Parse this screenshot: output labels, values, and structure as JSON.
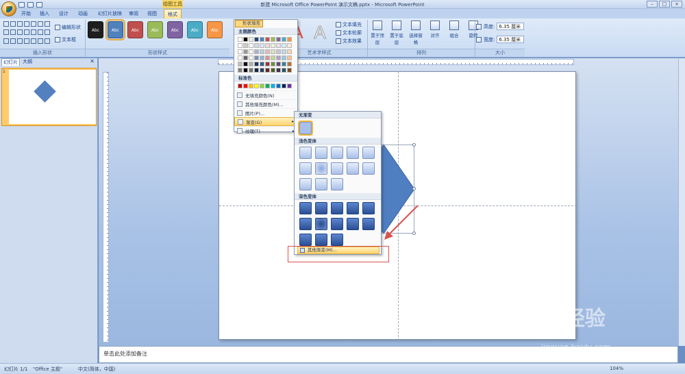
{
  "window": {
    "title": "新建 Microsoft Office PowerPoint 演示文稿.pptx - Microsoft PowerPoint",
    "contextual_tab": "绘图工具"
  },
  "tabs": [
    {
      "label": "开始"
    },
    {
      "label": "插入"
    },
    {
      "label": "设计"
    },
    {
      "label": "动画"
    },
    {
      "label": "幻灯片放映"
    },
    {
      "label": "审阅"
    },
    {
      "label": "视图"
    },
    {
      "label": "格式"
    }
  ],
  "ribbon": {
    "insert_shapes": {
      "label": "插入形状",
      "edit_shape": "编辑形状",
      "textbox": "文本框"
    },
    "shape_styles": {
      "label": "形状样式",
      "style_text": "Abc",
      "swatches": [
        "#1e1e1e",
        "#4f81bd",
        "#c0504d",
        "#9bbb59",
        "#8064a2",
        "#4bacc6",
        "#f79646"
      ]
    },
    "wordart": {
      "label": "艺术字样式",
      "text_fill": "文本填充",
      "text_outline": "文本轮廓",
      "text_effect": "文本效果"
    },
    "arrange": {
      "label": "排列",
      "bring_front": "置于顶层",
      "send_back": "置于底层",
      "select_pane": "选择窗格",
      "align": "对齐",
      "group": "组合",
      "rotate": "旋转"
    },
    "size": {
      "label": "大小",
      "height_label": "高度:",
      "height_value": "6.35 厘米",
      "width_label": "宽度:",
      "width_value": "6.35 厘米"
    }
  },
  "fill_menu": {
    "trigger": "形状填充",
    "theme_colors_label": "主题颜色",
    "standard_colors_label": "标准色",
    "theme_colors": [
      "#ffffff",
      "#000000",
      "#eeece1",
      "#1f497d",
      "#4f81bd",
      "#c0504d",
      "#9bbb59",
      "#8064a2",
      "#4bacc6",
      "#f79646"
    ],
    "standard_colors": [
      "#c00000",
      "#ff0000",
      "#ffc000",
      "#ffff00",
      "#92d050",
      "#00b050",
      "#00b0f0",
      "#0070c0",
      "#002060",
      "#7030a0"
    ],
    "items": [
      {
        "label": "无填充颜色(N)"
      },
      {
        "label": "其他填充颜色(M)..."
      },
      {
        "label": "图片(P)..."
      },
      {
        "label": "渐变(G)"
      },
      {
        "label": "纹理(T)"
      }
    ]
  },
  "gradient_menu": {
    "no_gradient": "无渐变",
    "light_variations": "浅色变体",
    "dark_variations": "深色变体",
    "more": "其他渐变(M)..."
  },
  "left_pane": {
    "tab_slides": "幻灯片",
    "tab_outline": "大纲",
    "slide_number": "1"
  },
  "notes": {
    "placeholder": "单击此处添加备注"
  },
  "status": {
    "slide": "幻灯片 1/1",
    "theme": "\"Office 主题\"",
    "language": "中文(简体，中国)",
    "zoom": "104%"
  },
  "watermark": {
    "brand": "Bai 经验",
    "url": "jingyan.baidu.com"
  }
}
